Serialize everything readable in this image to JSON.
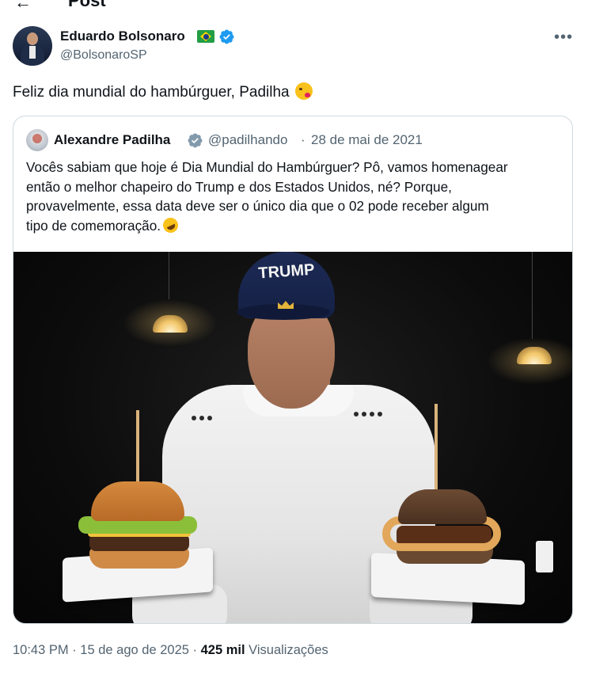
{
  "header": {
    "back_icon": "arrow-left-icon",
    "title": "Post"
  },
  "author": {
    "name": "Eduardo Bolsonaro",
    "flag_icon": "brazil-flag-icon",
    "verified_icon": "verified-badge-icon",
    "handle": "@BolsonaroSP",
    "more_icon": "more-horizontal-icon"
  },
  "tweet": {
    "text": "Feliz dia mundial do hambúrguer, Padilha",
    "emoji": "face-blowing-kiss-icon"
  },
  "quote": {
    "name": "Alexandre Padilha",
    "verified_icon": "verified-badge-icon",
    "handle": "@padilhando",
    "separator": "·",
    "date": "28 de mai de 2021",
    "text_lines": [
      "Vocês sabiam que hoje é Dia Mundial do Hambúrguer? Pô, vamos homenagear",
      "então o melhor chapeiro do Trump e dos Estados Unidos, né? Porque,",
      "provavelmente, essa data deve ser o único dia que o 02 pode receber algum",
      "tipo de comemoração."
    ],
    "emoji": "rolling-on-floor-laughing-icon",
    "photo": {
      "cap_text": "TRUMP"
    }
  },
  "meta": {
    "time": "10:43 PM",
    "sep1": " · ",
    "date": "15 de ago de 2025",
    "sep2": " · ",
    "views_count": "425 mil",
    "views_label": " Visualizações"
  },
  "colors": {
    "text_primary": "#0f1419",
    "text_secondary": "#536471",
    "border": "#cfd9de",
    "verified_blue": "#1d9bf0",
    "verified_gray": "#829aab"
  }
}
